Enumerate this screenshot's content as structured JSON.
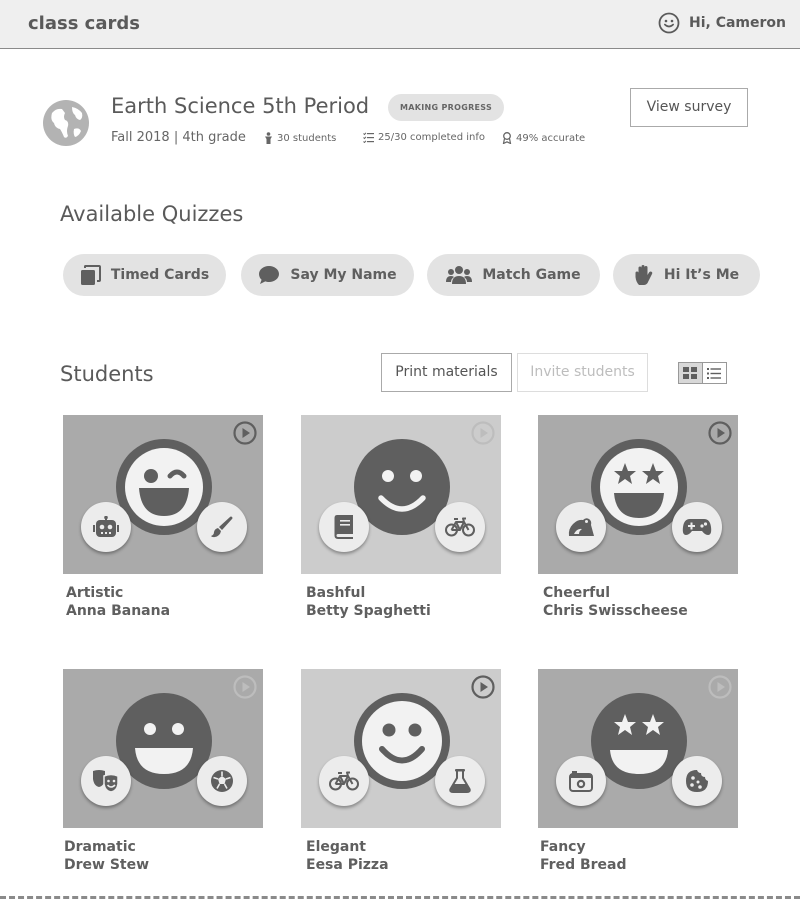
{
  "app": {
    "brand": "class cards",
    "greeting": "Hi, Cameron"
  },
  "class_info": {
    "title": "Earth Science 5th Period",
    "status_badge": "MAKING PROGRESS",
    "term": "Fall 2018 | 4th grade",
    "students_count": "30 students",
    "completed_info": "25/30 completed info",
    "accuracy": "49% accurate",
    "view_survey_label": "View survey"
  },
  "quizzes": {
    "title": "Available Quizzes",
    "items": [
      {
        "label": "Timed Cards",
        "icon": "cards-icon"
      },
      {
        "label": "Say My Name",
        "icon": "speech-bubble-icon"
      },
      {
        "label": "Match Game",
        "icon": "group-icon"
      },
      {
        "label": "Hi It’s Me",
        "icon": "hand-icon"
      }
    ]
  },
  "students": {
    "title": "Students",
    "print_label": "Print materials",
    "invite_label": "Invite students",
    "view_mode": "grid",
    "items": [
      {
        "trait": "Artistic",
        "name": "Anna Banana",
        "face": "wink",
        "left_icon": "robot-icon",
        "right_icon": "paintbrush-icon"
      },
      {
        "trait": "Bashful",
        "name": "Betty Spaghetti",
        "face": "smile",
        "left_icon": "book-icon",
        "right_icon": "bicycle-icon"
      },
      {
        "trait": "Cheerful",
        "name": "Chris Swisscheese",
        "face": "star-eyes",
        "left_icon": "frog-icon",
        "right_icon": "gamepad-icon"
      },
      {
        "trait": "Dramatic",
        "name": "Drew Stew",
        "face": "grin",
        "left_icon": "theater-masks-icon",
        "right_icon": "soccer-ball-icon"
      },
      {
        "trait": "Elegant",
        "name": "Eesa Pizza",
        "face": "smile-outline",
        "left_icon": "bicycle-icon",
        "right_icon": "flask-icon"
      },
      {
        "trait": "Fancy",
        "name": "Fred Bread",
        "face": "star-eyes",
        "left_icon": "camera-icon",
        "right_icon": "cookie-icon"
      }
    ]
  },
  "colors": {
    "header_bg": "#efefef",
    "button_bg": "#e3e3e3",
    "icon_dark": "#5f5f5f",
    "card_dark": "#aaaaaa",
    "card_light": "#cccccc"
  }
}
